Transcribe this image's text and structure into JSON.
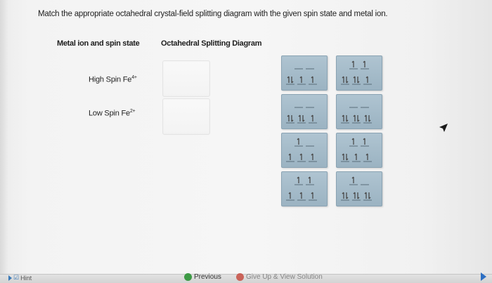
{
  "question": "Match the appropriate octahedral crystal-field splitting diagram with the given spin state and metal ion.",
  "headers": {
    "metal_ion": "Metal ion and spin state",
    "diagram": "Octahedral Splitting Diagram"
  },
  "rows": [
    {
      "label": "High Spin Fe",
      "charge": "4+"
    },
    {
      "label": "Low Spin Fe",
      "charge": "2+"
    }
  ],
  "diagram_options": [
    {
      "eg": [
        "",
        ""
      ],
      "t2g": [
        "1l",
        "1",
        "1"
      ]
    },
    {
      "eg": [
        "1",
        "1"
      ],
      "t2g": [
        "1l",
        "1l",
        "1"
      ]
    },
    {
      "eg": [
        "",
        ""
      ],
      "t2g": [
        "1l",
        "1l",
        "1"
      ]
    },
    {
      "eg": [
        "",
        ""
      ],
      "t2g": [
        "1l",
        "1l",
        "1l"
      ]
    },
    {
      "eg": [
        "1",
        ""
      ],
      "t2g": [
        "1",
        "1",
        "1"
      ]
    },
    {
      "eg": [
        "1",
        "1"
      ],
      "t2g": [
        "1l",
        "1",
        "1"
      ]
    },
    {
      "eg": [
        "1",
        "1"
      ],
      "t2g": [
        "1",
        "1",
        "1"
      ]
    },
    {
      "eg": [
        "1",
        ""
      ],
      "t2g": [
        "1l",
        "1l",
        "1l"
      ]
    }
  ],
  "footer": {
    "hint": "Hint",
    "previous": "Previous",
    "give_up": "Give Up & View Solution"
  },
  "colors": {
    "tile": "#a6bccb",
    "tile_border": "#8aa3b3",
    "arrow": "#4a4a4a",
    "previous_icon": "#3d9a45",
    "give_up_icon": "#c43b2e",
    "next_arrow": "#2d6fc3"
  }
}
